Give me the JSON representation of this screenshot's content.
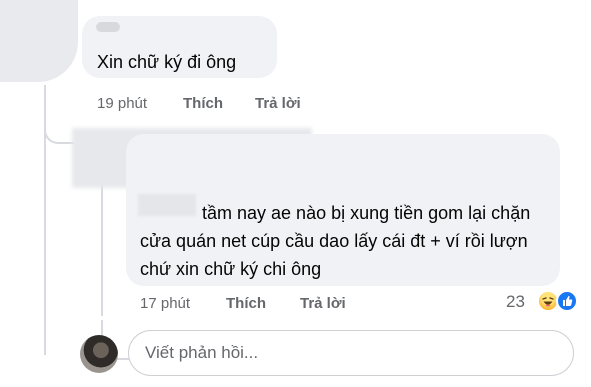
{
  "comment1": {
    "text": "Xin chữ ký đi ông",
    "time": "19 phút",
    "like_label": "Thích",
    "reply_label": "Trả lời"
  },
  "comment2": {
    "text": "tầm nay ae nào bị xung tiền gom lại chặn cửa quán net cúp cầu dao lấy cái đt + ví rồi lượn chứ xin chữ ký chi ông",
    "time": "17 phút",
    "like_label": "Thích",
    "reply_label": "Trả lời",
    "reaction_count": "23",
    "reaction_icons": [
      "haha-icon",
      "like-icon"
    ]
  },
  "reply_box": {
    "placeholder": "Viết phản hồi..."
  },
  "colors": {
    "bubble": "#f0f2f5",
    "meta_text": "#65676b",
    "like_blue": "#1877f2",
    "haha_yellow": "#f7b125"
  }
}
